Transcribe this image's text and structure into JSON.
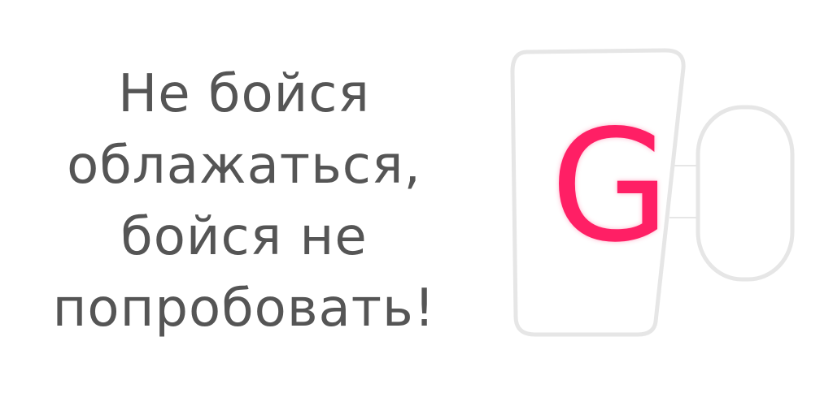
{
  "slogan": {
    "lines": [
      "Не бойся",
      "облажаться,",
      "бойся не",
      "попробовать!"
    ]
  },
  "logo": {
    "letter": "G",
    "letter_color": "#FF1F65",
    "outline_color": "#E6E6E6",
    "icon": "glass-cup-with-handle-icon"
  }
}
